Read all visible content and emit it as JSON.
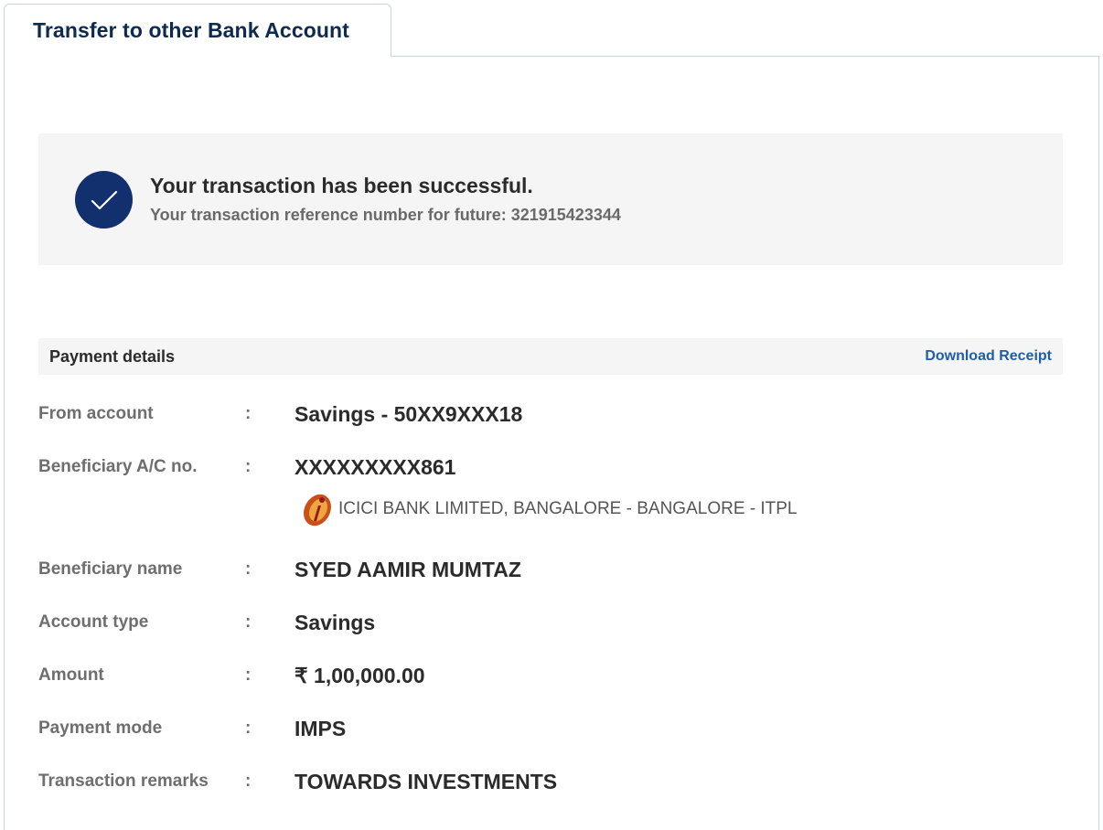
{
  "tab": {
    "label": "Transfer to other Bank Account"
  },
  "success": {
    "title": "Your transaction has been successful.",
    "reference": "Your transaction reference number for future: 321915423344",
    "icon": "checkmark-icon",
    "icon_color": "#122f6e"
  },
  "details": {
    "title": "Payment details",
    "download_label": "Download Receipt",
    "separator": ":",
    "rows": [
      {
        "label": "From account",
        "value": "Savings - 50XX9XXX18"
      },
      {
        "label": "Beneficiary A/C no.",
        "value": "XXXXXXXXX861"
      },
      {
        "label": "Beneficiary name",
        "value": "SYED AAMIR MUMTAZ"
      },
      {
        "label": "Account type",
        "value": "Savings"
      },
      {
        "label": "Amount",
        "value": "₹ 1,00,000.00"
      },
      {
        "label": "Payment mode",
        "value": "IMPS"
      },
      {
        "label": "Transaction remarks",
        "value": "TOWARDS INVESTMENTS"
      }
    ],
    "bank": {
      "name": "ICICI BANK LIMITED, BANGALORE - BANGALORE - ITPL",
      "logo": "icici-bank-logo"
    }
  },
  "colors": {
    "accent": "#0f2a4f",
    "link": "#1f5fa5",
    "box_bg": "#f5f5f5"
  }
}
